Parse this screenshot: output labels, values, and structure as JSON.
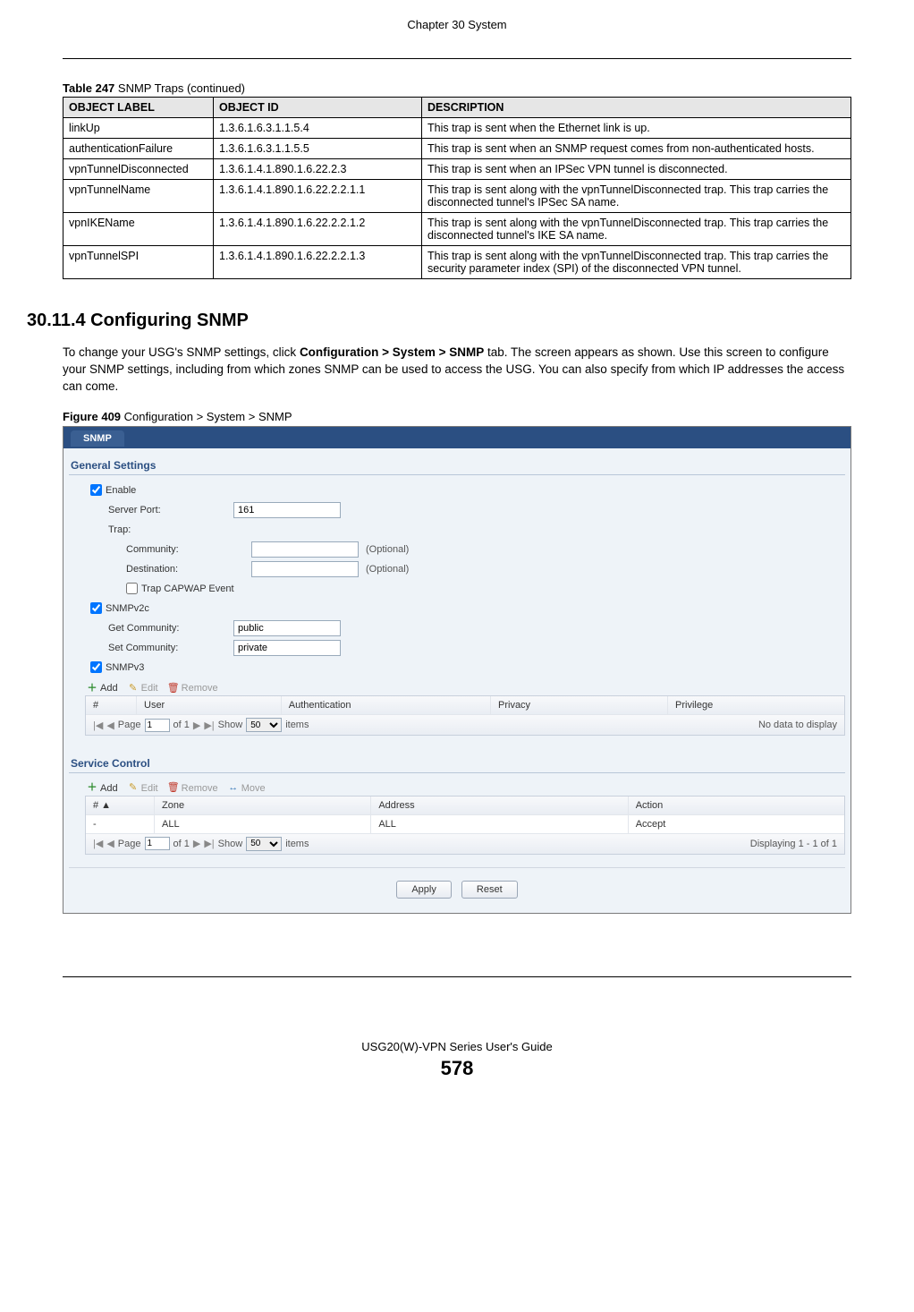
{
  "header": {
    "chapter": "Chapter 30 System"
  },
  "table_caption": {
    "label_bold": "Table 247",
    "label_rest": "   SNMP Traps (continued)"
  },
  "table": {
    "headers": [
      "OBJECT LABEL",
      "OBJECT ID",
      "DESCRIPTION"
    ],
    "rows": [
      {
        "label": "linkUp",
        "oid": "1.3.6.1.6.3.1.1.5.4",
        "desc": "This trap is sent when the Ethernet link is up."
      },
      {
        "label": "authenticationFailure",
        "oid": "1.3.6.1.6.3.1.1.5.5",
        "desc": "This trap is sent when an SNMP request comes from non-authenticated hosts."
      },
      {
        "label": "vpnTunnelDisconnected",
        "oid": "1.3.6.1.4.1.890.1.6.22.2.3",
        "desc": "This trap is sent when an IPSec VPN tunnel is disconnected."
      },
      {
        "label": "vpnTunnelName",
        "oid": "1.3.6.1.4.1.890.1.6.22.2.2.1.1",
        "desc": "This trap is sent along with the vpnTunnelDisconnected trap. This trap carries the disconnected tunnel's IPSec SA name."
      },
      {
        "label": "vpnIKEName",
        "oid": "1.3.6.1.4.1.890.1.6.22.2.2.1.2",
        "desc": "This trap is sent along with the vpnTunnelDisconnected trap. This trap carries the disconnected tunnel's IKE SA name."
      },
      {
        "label": "vpnTunnelSPI",
        "oid": "1.3.6.1.4.1.890.1.6.22.2.2.1.3",
        "desc": "This trap is sent along with the vpnTunnelDisconnected trap. This trap carries the security parameter index (SPI) of the disconnected VPN tunnel."
      }
    ]
  },
  "section": {
    "number_title": "30.11.4  Configuring SNMP",
    "paragraph_a": "To change your USG's SNMP settings, click ",
    "paragraph_bold": "Configuration > System > SNMP",
    "paragraph_b": " tab. The screen appears as shown. Use this screen to configure your SNMP settings, including from which zones SNMP can be used to access the USG. You can also specify from which IP addresses the access can come."
  },
  "figure_caption": {
    "bold": "Figure 409",
    "rest": "   Configuration > System > SNMP"
  },
  "screenshot": {
    "tab": "SNMP",
    "general_settings": {
      "title": "General Settings",
      "enable": "Enable",
      "server_port_label": "Server Port:",
      "server_port_value": "161",
      "trap_label": "Trap:",
      "community_label": "Community:",
      "community_value": "",
      "destination_label": "Destination:",
      "destination_value": "",
      "optional": "(Optional)",
      "trap_capwap": "Trap CAPWAP Event",
      "snmpv2c": "SNMPv2c",
      "get_community_label": "Get Community:",
      "get_community_value": "public",
      "set_community_label": "Set Community:",
      "set_community_value": "private",
      "snmpv3": "SNMPv3"
    },
    "toolbar": {
      "add": "Add",
      "edit": "Edit",
      "remove": "Remove",
      "move": "Move"
    },
    "grid1": {
      "headers": {
        "num": "#",
        "user": "User",
        "auth": "Authentication",
        "priv": "Privacy",
        "privil": "Privilege"
      },
      "no_data": "No data to display"
    },
    "pager": {
      "page_label": "Page",
      "page_value": "1",
      "of_label": "of 1",
      "show_label": "Show",
      "show_value": "50",
      "items_label": "items"
    },
    "service_control": {
      "title": "Service Control"
    },
    "grid2": {
      "headers": {
        "num": "# ▲",
        "zone": "Zone",
        "address": "Address",
        "action": "Action"
      },
      "row": {
        "num": "-",
        "zone": "ALL",
        "address": "ALL",
        "action": "Accept"
      },
      "displaying": "Displaying 1 - 1 of 1"
    },
    "buttons": {
      "apply": "Apply",
      "reset": "Reset"
    }
  },
  "footer": {
    "guide": "USG20(W)-VPN Series User's Guide",
    "page": "578"
  }
}
